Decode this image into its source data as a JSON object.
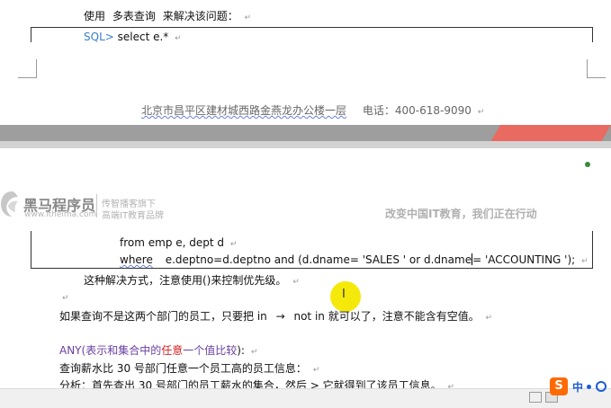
{
  "doc": {
    "top_line": {
      "text1": "使用",
      "text2": "多表查询",
      "text3": "来解决该问题：",
      "para_mark": "↵"
    },
    "sql_line": {
      "prompt": "SQL>",
      "code": "select e.*",
      "para_mark": "↵"
    },
    "footer": {
      "address": "北京市昌平区建材城西路金燕龙办公楼一层",
      "phone": "电话：400-618-9090",
      "para_mark": "↵"
    },
    "header": {
      "logo_main": "黑马程序员",
      "logo_url": "www.itheima.com",
      "tagline1": "传智播客旗下",
      "tagline2": "高端IT教育品牌",
      "slogan": "改变中国IT教育，我们正在行动"
    },
    "code_lines": {
      "from_line": "from emp e, dept d",
      "where_kw": "where",
      "where_rest_a": "e.deptno=d.deptno and (d.dname= 'SALES ' or d.dname",
      "where_rest_b": "= 'ACCOUNTING ');",
      "para_mark": "↵"
    },
    "body": {
      "line1": "这种解决方式，注意使用()来控制优先级。",
      "line2_a": "如果查询不是这两个部门的员工，只要把 in",
      "line2_arrow": "→",
      "line2_b": "not in 就可以了，注意不能含有空值。",
      "any_kw": "ANY(",
      "any_mid": "表示和集合中的",
      "any_red": "任意",
      "any_end": "一个值比较",
      "any_close": "):",
      "line4": "查询薪水比 30 号部门任意一个员工高的员工信息：",
      "line5": "分析：首先查出 30 号部门的员工薪水的集合，然后 > 它就得到了该员工信息。",
      "para_mark": "↵"
    },
    "cursor_glyph": "I",
    "ime": {
      "label": "中",
      "icon": "sogou-icon"
    }
  }
}
